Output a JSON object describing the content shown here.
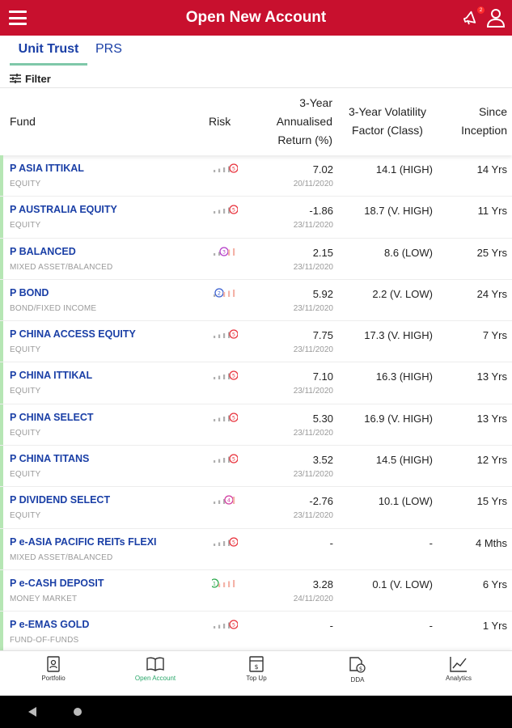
{
  "header": {
    "title": "Open New Account",
    "notification_count": "2"
  },
  "tabs": [
    {
      "label": "Unit Trust",
      "active": true
    },
    {
      "label": "PRS",
      "active": false
    }
  ],
  "filter_label": "Filter",
  "table": {
    "columns": {
      "fund": "Fund",
      "risk": "Risk",
      "return_l1": "3-Year",
      "return_l2": "Annualised",
      "return_l3": "Return (%)",
      "vol_l1": "3-Year Volatility",
      "vol_l2": "Factor (Class)",
      "since_l1": "Since",
      "since_l2": "Inception"
    },
    "rows": [
      {
        "name": "P ASIA ITTIKAL",
        "category": "EQUITY",
        "risk_level": "5",
        "risk_color": "#e8323c",
        "return": "7.02",
        "date": "20/11/2020",
        "volatility": "14.1 (HIGH)",
        "since": "14 Yrs"
      },
      {
        "name": "P AUSTRALIA EQUITY",
        "category": "EQUITY",
        "risk_level": "5",
        "risk_color": "#e8323c",
        "return": "-1.86",
        "date": "23/11/2020",
        "volatility": "18.7 (V. HIGH)",
        "since": "11 Yrs"
      },
      {
        "name": "P BALANCED",
        "category": "MIXED ASSET/BALANCED",
        "risk_level": "3",
        "risk_color": "#b43cc8",
        "return": "2.15",
        "date": "23/11/2020",
        "volatility": "8.6 (LOW)",
        "since": "25 Yrs"
      },
      {
        "name": "P BOND",
        "category": "BOND/FIXED INCOME",
        "risk_level": "2",
        "risk_color": "#3a5fd0",
        "return": "5.92",
        "date": "23/11/2020",
        "volatility": "2.2 (V. LOW)",
        "since": "24 Yrs"
      },
      {
        "name": "P CHINA ACCESS EQUITY",
        "category": "EQUITY",
        "risk_level": "5",
        "risk_color": "#e8323c",
        "return": "7.75",
        "date": "23/11/2020",
        "volatility": "17.3 (V. HIGH)",
        "since": "7 Yrs"
      },
      {
        "name": "P CHINA ITTIKAL",
        "category": "EQUITY",
        "risk_level": "5",
        "risk_color": "#e8323c",
        "return": "7.10",
        "date": "23/11/2020",
        "volatility": "16.3 (HIGH)",
        "since": "13 Yrs"
      },
      {
        "name": "P CHINA SELECT",
        "category": "EQUITY",
        "risk_level": "5",
        "risk_color": "#e8323c",
        "return": "5.30",
        "date": "23/11/2020",
        "volatility": "16.9 (V. HIGH)",
        "since": "13 Yrs"
      },
      {
        "name": "P CHINA TITANS",
        "category": "EQUITY",
        "risk_level": "5",
        "risk_color": "#e8323c",
        "return": "3.52",
        "date": "23/11/2020",
        "volatility": "14.5 (HIGH)",
        "since": "12 Yrs"
      },
      {
        "name": "P DIVIDEND SELECT",
        "category": "EQUITY",
        "risk_level": "4",
        "risk_color": "#d23ca0",
        "return": "-2.76",
        "date": "23/11/2020",
        "volatility": "10.1 (LOW)",
        "since": "15 Yrs"
      },
      {
        "name": "P e-ASIA PACIFIC REITs FLEXI",
        "category": "MIXED ASSET/BALANCED",
        "risk_level": "5",
        "risk_color": "#e8323c",
        "return": "-",
        "date": "",
        "volatility": "-",
        "since": "4 Mths"
      },
      {
        "name": "P e-CASH DEPOSIT",
        "category": "MONEY MARKET",
        "risk_level": "1",
        "risk_color": "#2aa84a",
        "return": "3.28",
        "date": "24/11/2020",
        "volatility": "0.1 (V. LOW)",
        "since": "6 Yrs"
      },
      {
        "name": "P e-EMAS GOLD",
        "category": "FUND-OF-FUNDS",
        "risk_level": "5",
        "risk_color": "#e8323c",
        "return": "-",
        "date": "",
        "volatility": "-",
        "since": "1 Yrs"
      }
    ]
  },
  "bottom_nav": [
    {
      "label": "Portfolio",
      "icon": "portfolio-icon",
      "active": false
    },
    {
      "label": "Open Account",
      "icon": "open-account-icon",
      "active": true
    },
    {
      "label": "Top Up",
      "icon": "top-up-icon",
      "active": false
    },
    {
      "label": "DDA",
      "icon": "dda-icon",
      "active": false
    },
    {
      "label": "Analytics",
      "icon": "analytics-icon",
      "active": false
    }
  ],
  "colors": {
    "brand_red": "#c8102e",
    "link_blue": "#1a3fa6",
    "active_green": "#2aa76a",
    "row_strip": "#b6e6b4"
  }
}
